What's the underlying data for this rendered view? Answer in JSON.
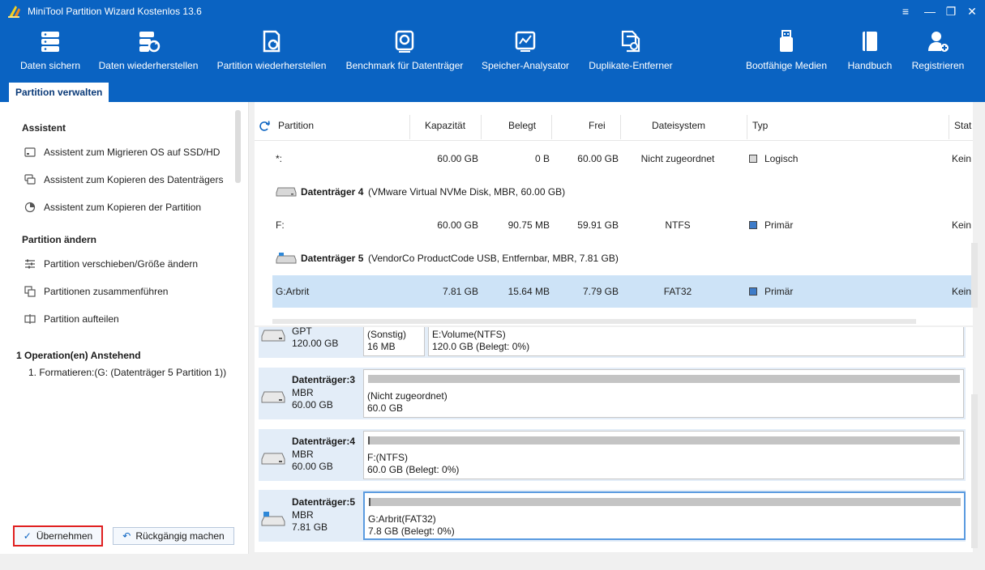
{
  "window": {
    "title": "MiniTool Partition Wizard Kostenlos 13.6",
    "controls": {
      "menu": "≡",
      "minimize": "—",
      "restore": "❐",
      "close": "✕"
    }
  },
  "toolbar": {
    "items": [
      {
        "label": "Daten sichern",
        "icon": "backup-icon"
      },
      {
        "label": "Daten wiederherstellen",
        "icon": "data-recovery-icon"
      },
      {
        "label": "Partition wiederherstellen",
        "icon": "partition-recovery-icon"
      },
      {
        "label": "Benchmark für Datenträger",
        "icon": "benchmark-icon"
      },
      {
        "label": "Speicher-Analysator",
        "icon": "space-analyzer-icon"
      },
      {
        "label": "Duplikate-Entferner",
        "icon": "duplicate-remover-icon"
      },
      {
        "label": "Bootfähige Medien",
        "icon": "bootable-media-icon"
      },
      {
        "label": "Handbuch",
        "icon": "manual-icon"
      },
      {
        "label": "Registrieren",
        "icon": "register-icon"
      }
    ]
  },
  "tabs": {
    "active": "Partition verwalten"
  },
  "sidebar": {
    "wizard_title": "Assistent",
    "wizard_items": [
      "Assistent zum Migrieren OS auf SSD/HD",
      "Assistent zum Kopieren des Datenträgers",
      "Assistent zum Kopieren der Partition"
    ],
    "change_title": "Partition ändern",
    "change_items": [
      "Partition verschieben/Größe ändern",
      "Partitionen zusammenführen",
      "Partition aufteilen"
    ],
    "pending_title": "1 Operation(en) Anstehend",
    "pending_items": [
      "1. Formatieren:(G: (Datenträger 5 Partition 1))"
    ],
    "apply_label": "Übernehmen",
    "undo_label": "Rückgängig machen"
  },
  "table": {
    "headers": [
      "Partition",
      "Kapazität",
      "Belegt",
      "Frei",
      "Dateisystem",
      "Typ",
      "Stat"
    ],
    "rows": [
      {
        "kind": "partition",
        "partition": "*:",
        "capacity": "60.00 GB",
        "used": "0 B",
        "free": "60.00 GB",
        "fs": "Nicht zugeordnet",
        "type": "Logisch",
        "status": "Kein",
        "type_color": "#d9d9d9"
      },
      {
        "kind": "disk",
        "name": "Datenträger 4",
        "desc": "(VMware Virtual NVMe Disk, MBR, 60.00 GB)"
      },
      {
        "kind": "partition",
        "partition": "F:",
        "capacity": "60.00 GB",
        "used": "90.75 MB",
        "free": "59.91 GB",
        "fs": "NTFS",
        "type": "Primär",
        "status": "Kein",
        "type_color": "#3d7bc8"
      },
      {
        "kind": "disk",
        "name": "Datenträger 5",
        "desc": "(VendorCo ProductCode USB, Entfernbar, MBR, 7.81 GB)"
      },
      {
        "kind": "partition",
        "partition": "G:Arbrit",
        "capacity": "7.81 GB",
        "used": "15.64 MB",
        "free": "7.79 GB",
        "fs": "FAT32",
        "type": "Primär",
        "status": "Kein",
        "type_color": "#3d7bc8",
        "selected": true
      }
    ]
  },
  "diskmap": {
    "disks": [
      {
        "name": "",
        "type": "GPT",
        "size": "120.00 GB",
        "partitions": [
          {
            "line1": "(Sonstig)",
            "line2": "16 MB"
          },
          {
            "line1": "E:Volume(NTFS)",
            "line2": "120.0 GB (Belegt: 0%)"
          }
        ]
      },
      {
        "name": "Datenträger:3",
        "type": "MBR",
        "size": "60.00 GB",
        "partitions": [
          {
            "line1": "(Nicht zugeordnet)",
            "line2": "60.0 GB"
          }
        ]
      },
      {
        "name": "Datenträger:4",
        "type": "MBR",
        "size": "60.00 GB",
        "partitions": [
          {
            "line1": "F:(NTFS)",
            "line2": "60.0 GB (Belegt: 0%)"
          }
        ]
      },
      {
        "name": "Datenträger:5",
        "type": "MBR",
        "size": "7.81 GB",
        "partitions": [
          {
            "line1": "G:Arbrit(FAT32)",
            "line2": "7.8 GB (Belegt: 0%)"
          }
        ]
      }
    ]
  },
  "colors": {
    "accent": "#0a63c2",
    "selection": "#cde3f7",
    "apply_border": "#e02020"
  }
}
